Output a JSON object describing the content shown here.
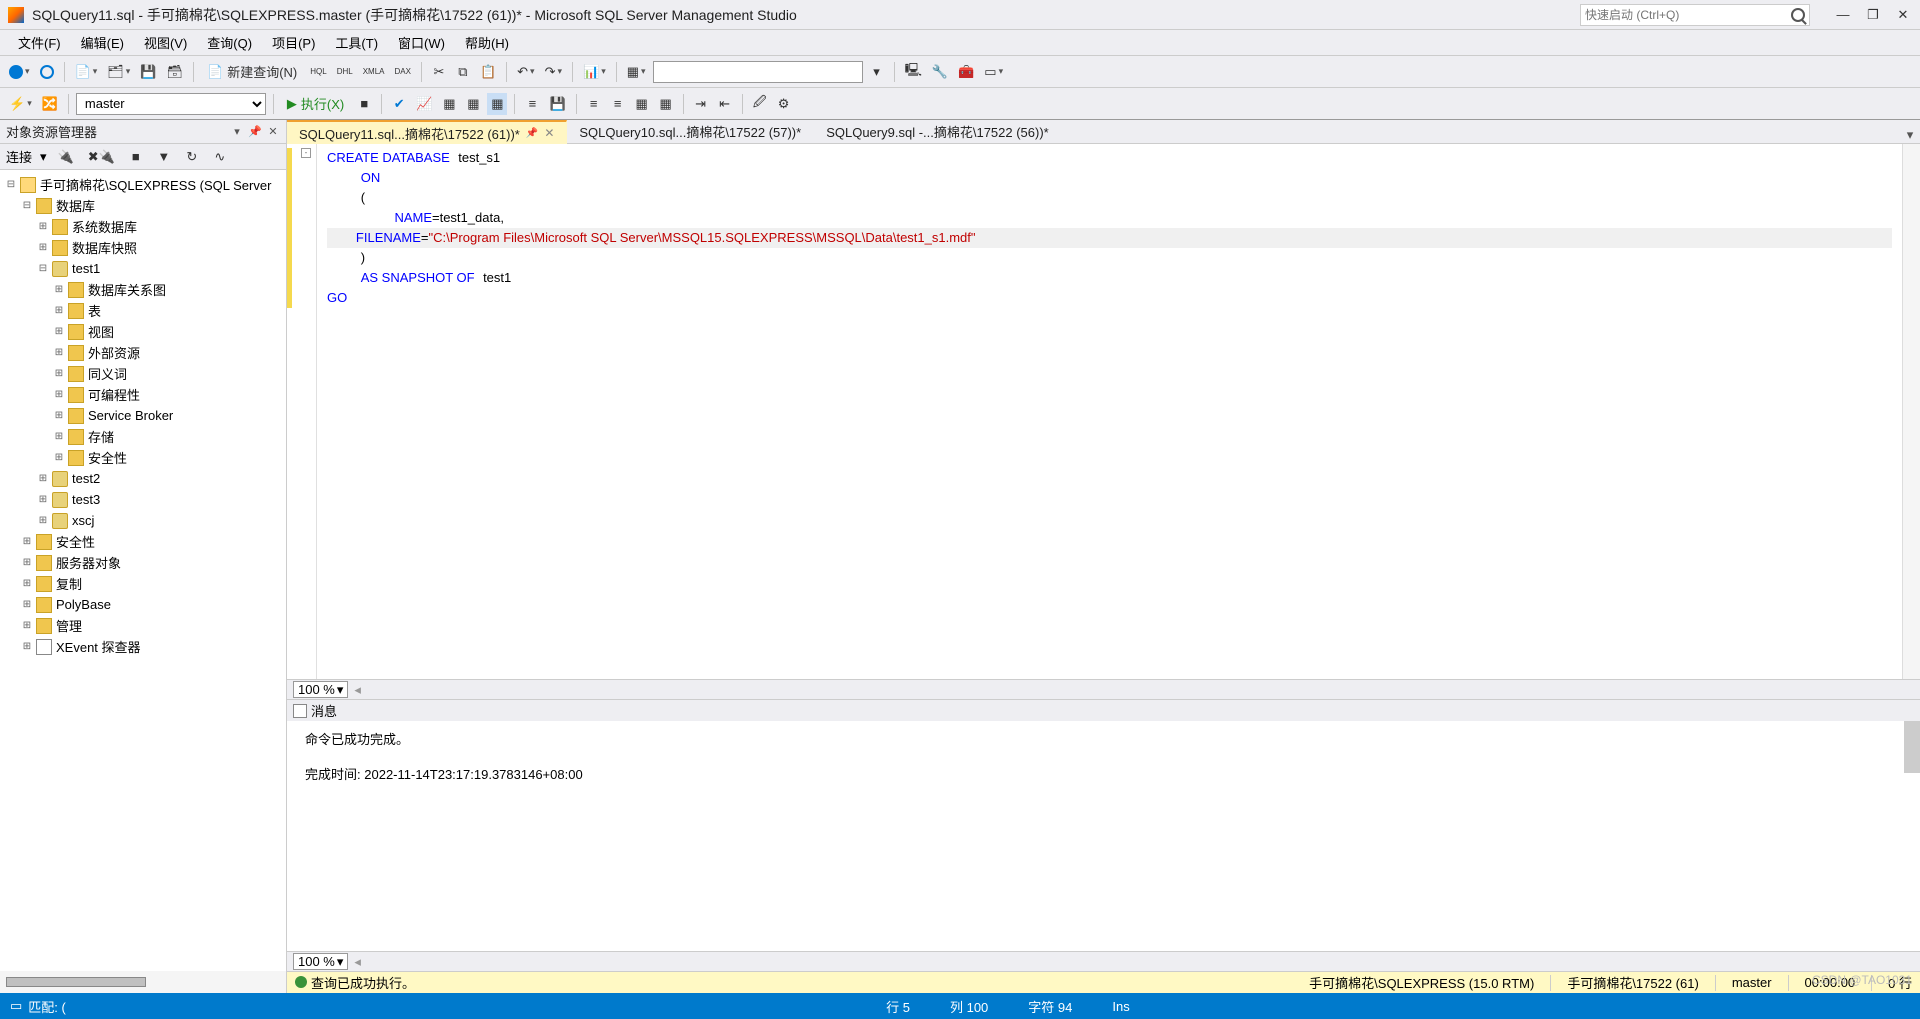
{
  "title_bar": {
    "title": "SQLQuery11.sql - 手可摘棉花\\SQLEXPRESS.master (手可摘棉花\\17522 (61))* - Microsoft SQL Server Management Studio",
    "quick_launch_placeholder": "快速启动 (Ctrl+Q)"
  },
  "menu": {
    "items": [
      "文件(F)",
      "编辑(E)",
      "视图(V)",
      "查询(Q)",
      "项目(P)",
      "工具(T)",
      "窗口(W)",
      "帮助(H)"
    ]
  },
  "toolbar1": {
    "new_query": "新建查询(N)",
    "small_icons": [
      "HQL",
      "DHL",
      "XMLA",
      "DAX"
    ]
  },
  "toolbar2": {
    "db_combo": "master",
    "execute": "执行(X)"
  },
  "sidebar": {
    "title": "对象资源管理器",
    "connect_label": "连接",
    "tree": {
      "server": "手可摘棉花\\SQLEXPRESS (SQL Server",
      "databases": "数据库",
      "children": [
        {
          "l": "系统数据库",
          "d": 2,
          "e": "+",
          "i": "fold"
        },
        {
          "l": "数据库快照",
          "d": 2,
          "e": "+",
          "i": "fold"
        },
        {
          "l": "test1",
          "d": 2,
          "e": "-",
          "i": "db"
        },
        {
          "l": "数据库关系图",
          "d": 3,
          "e": "+",
          "i": "fold"
        },
        {
          "l": "表",
          "d": 3,
          "e": "+",
          "i": "fold"
        },
        {
          "l": "视图",
          "d": 3,
          "e": "+",
          "i": "fold"
        },
        {
          "l": "外部资源",
          "d": 3,
          "e": "+",
          "i": "fold"
        },
        {
          "l": "同义词",
          "d": 3,
          "e": "+",
          "i": "fold"
        },
        {
          "l": "可编程性",
          "d": 3,
          "e": "+",
          "i": "fold"
        },
        {
          "l": "Service Broker",
          "d": 3,
          "e": "+",
          "i": "fold"
        },
        {
          "l": "存储",
          "d": 3,
          "e": "+",
          "i": "fold"
        },
        {
          "l": "安全性",
          "d": 3,
          "e": "+",
          "i": "fold"
        },
        {
          "l": "test2",
          "d": 2,
          "e": "+",
          "i": "db"
        },
        {
          "l": "test3",
          "d": 2,
          "e": "+",
          "i": "db"
        },
        {
          "l": "xscj",
          "d": 2,
          "e": "+",
          "i": "db"
        },
        {
          "l": "安全性",
          "d": 1,
          "e": "+",
          "i": "fold"
        },
        {
          "l": "服务器对象",
          "d": 1,
          "e": "+",
          "i": "fold"
        },
        {
          "l": "复制",
          "d": 1,
          "e": "+",
          "i": "fold"
        },
        {
          "l": "PolyBase",
          "d": 1,
          "e": "+",
          "i": "fold"
        },
        {
          "l": "管理",
          "d": 1,
          "e": "+",
          "i": "fold"
        },
        {
          "l": "XEvent 探查器",
          "d": 1,
          "e": "+",
          "i": "xe"
        }
      ]
    }
  },
  "tabs": {
    "items": [
      {
        "label": "SQLQuery11.sql...摘棉花\\17522 (61))*",
        "active": true
      },
      {
        "label": "SQLQuery10.sql...摘棉花\\17522 (57))*",
        "active": false
      },
      {
        "label": "SQLQuery9.sql -...摘棉花\\17522 (56))*",
        "active": false
      }
    ]
  },
  "code": {
    "tokens": {
      "create_database": "CREATE DATABASE",
      "dbname": "test_s1",
      "on": "ON",
      "lparen": "(",
      "name": "NAME",
      "eq": "=",
      "nameval": "test1_data",
      "comma": ",",
      "filename": "FILENAME",
      "filepath": "\"C:\\Program Files\\Microsoft SQL Server\\MSSQL15.SQLEXPRESS\\MSSQL\\Data\\test1_s1.mdf\"",
      "rparen": ")",
      "as_snapshot": "AS SNAPSHOT OF",
      "srcdb": "test1",
      "go": "GO"
    }
  },
  "zoom": {
    "code_pct": "100 %",
    "msg_pct": "100 %"
  },
  "messages": {
    "title": "消息",
    "line1": "命令已成功完成。",
    "line2_label": "完成时间:",
    "line2_ts": "2022-11-14T23:17:19.3783146+08:00"
  },
  "status": {
    "exec_ok": "查询已成功执行。",
    "server": "手可摘棉花\\SQLEXPRESS (15.0 RTM)",
    "user": "手可摘棉花\\17522 (61)",
    "db": "master",
    "elapsed": "00:00:00",
    "rows": "0 行"
  },
  "bottom": {
    "match": "匹配: (",
    "line": "行 5",
    "col": "列 100",
    "char": "字符 94",
    "ins": "Ins"
  },
  "watermark": "CSDN @TAO1031"
}
